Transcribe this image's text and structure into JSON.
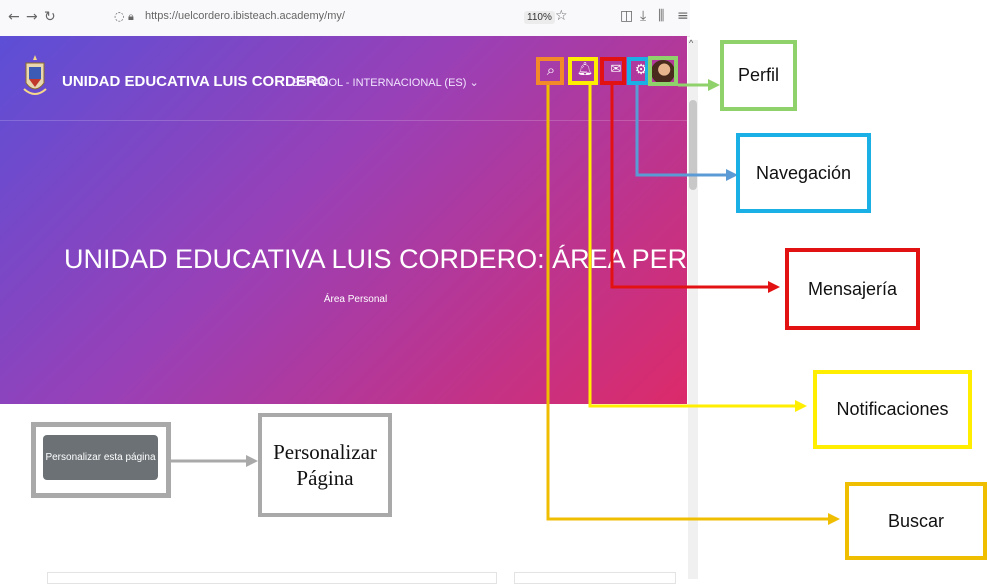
{
  "browser": {
    "url": "https://uelcordero.ibisteach.academy/my/",
    "zoom": "110%"
  },
  "site": {
    "name": "UNIDAD EDUCATIVA LUIS CORDERO",
    "language": "ESPAÑOL - INTERNACIONAL (ES) ⌄"
  },
  "hero": {
    "title": "UNIDAD EDUCATIVA LUIS CORDERO: ÁREA PERSONAL",
    "subtitle": "Área Personal"
  },
  "customize_button": "Personalizar esta página",
  "callouts": {
    "perfil": "Perfil",
    "navegacion": "Navegación",
    "mensajeria": "Mensajería",
    "notificaciones": "Notificaciones",
    "buscar": "Buscar",
    "personalizar_line1": "Personalizar",
    "personalizar_line2": "Página"
  },
  "icons": {
    "search": "search-icon",
    "notifications": "bell-icon",
    "messaging": "chat-icon",
    "navigation": "gear-icon",
    "profile": "avatar"
  },
  "colors": {
    "perfil": "#8fd16a",
    "navegacion": "#1ab0e6",
    "mensajeria": "#e31212",
    "notificaciones": "#ffee00",
    "buscar": "#f0be00",
    "personalizar": "#a9a9a9",
    "search_box": "#f28a2a"
  }
}
